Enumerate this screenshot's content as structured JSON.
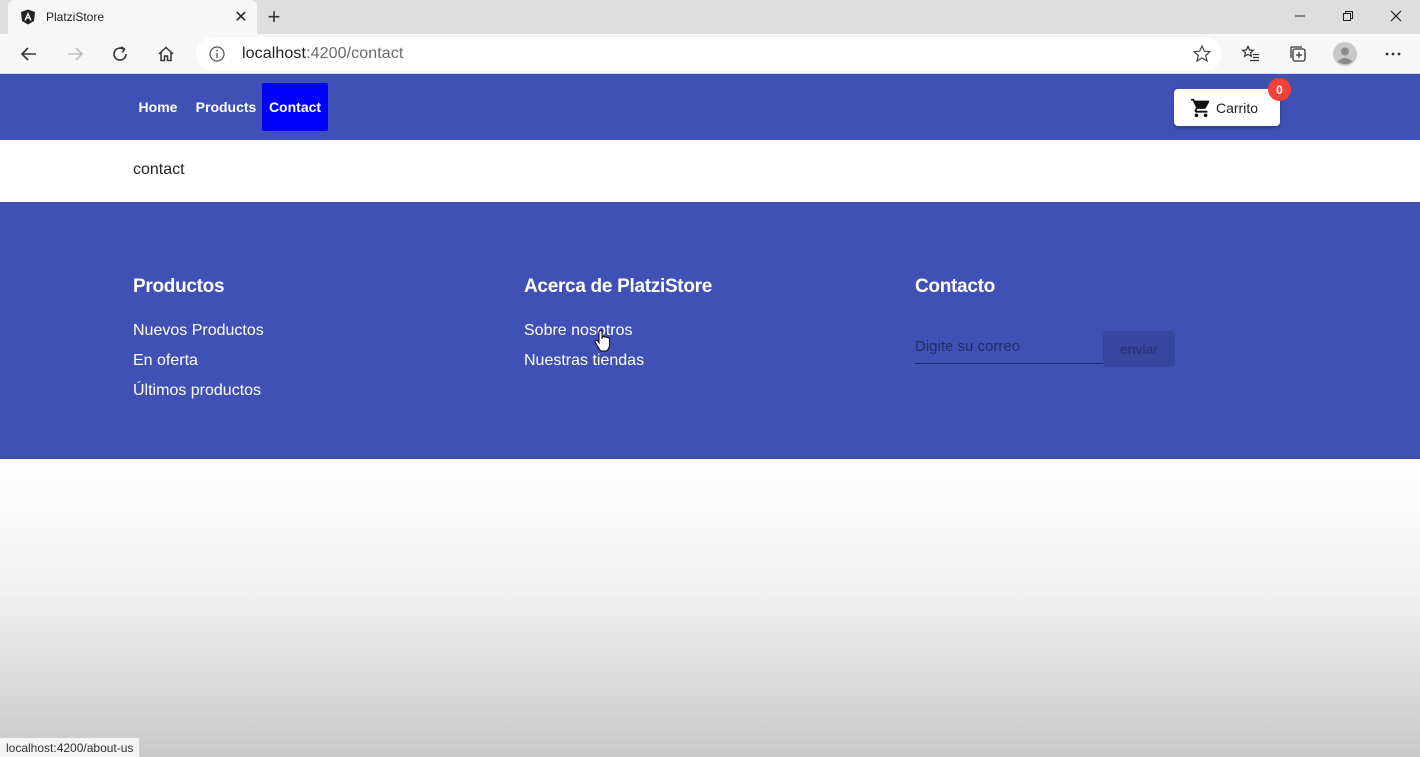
{
  "browser": {
    "tab": {
      "title": "PlatziStore",
      "favicon": "angular-icon",
      "close_label": "✕"
    },
    "new_tab_label": "+",
    "url": {
      "host": "localhost",
      "path": ":4200/contact"
    },
    "status_url": "localhost:4200/about-us"
  },
  "navbar": {
    "links": [
      {
        "label": "Home",
        "active": false
      },
      {
        "label": "Products",
        "active": false
      },
      {
        "label": "Contact",
        "active": true
      }
    ],
    "cart": {
      "label": "Carrito",
      "count": "0",
      "icon": "shopping-cart-icon"
    }
  },
  "main": {
    "text": "contact"
  },
  "footer": {
    "columns": [
      {
        "heading": "Productos",
        "links": [
          "Nuevos Productos",
          "En oferta",
          "Últimos productos"
        ]
      },
      {
        "heading": "Acerca de PlatziStore",
        "links": [
          "Sobre nosotros",
          "Nuestras tiendas"
        ]
      },
      {
        "heading": "Contacto",
        "links": []
      }
    ],
    "email_placeholder": "Digite su correo",
    "send_label": "enviar"
  },
  "colors": {
    "primary": "#3f51b5",
    "active_link": "#0000ff",
    "badge": "#f44336"
  }
}
